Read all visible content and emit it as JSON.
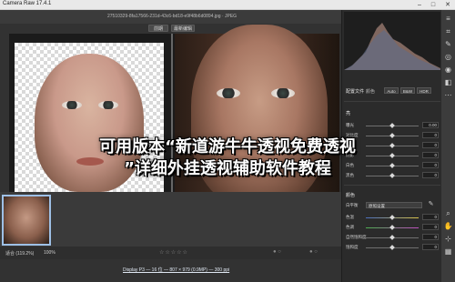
{
  "window": {
    "title": "Camera Raw 17.4.1",
    "minimize_glyph": "–",
    "maximize_glyph": "□",
    "close_glyph": "✕"
  },
  "file": {
    "name": "27510329-8fa17566-231d-43c6-bd18-e9f48b6d0894.jpg  ·  JPEG"
  },
  "view_tabs": [
    {
      "label": "前期"
    },
    {
      "label": "最新编辑"
    }
  ],
  "status": {
    "zoom_fit": "适合 (119.2%)",
    "zoom_100": "100%",
    "stars": "☆☆☆☆☆",
    "dots_left": "● ○",
    "dots_right": "● ○"
  },
  "info_link": "Display P3 — 16 位 — 807 × 979 (0.9MP) — 300 ppi",
  "panel": {
    "profile_label": "配置文件",
    "profile_value": "颜色",
    "mode_auto": "Auto",
    "mode_bw": "B&W",
    "mode_hdr": "HDR",
    "light_section": "亮",
    "light_sliders": [
      {
        "label": "曝光",
        "value": "0.00",
        "knob_pos": 0.5
      },
      {
        "label": "对比度",
        "value": "0",
        "knob_pos": 0.5
      },
      {
        "label": "高光",
        "value": "0",
        "knob_pos": 0.5
      },
      {
        "label": "阴影",
        "value": "0",
        "knob_pos": 0.5
      },
      {
        "label": "白色",
        "value": "0",
        "knob_pos": 0.5
      },
      {
        "label": "黑色",
        "value": "0",
        "knob_pos": 0.5
      }
    ],
    "color_section": "颜色",
    "white_balance_label": "白平衡",
    "white_balance_value": "原照设置",
    "color_sliders": [
      {
        "label": "色温",
        "value": "0",
        "knob_pos": 0.5
      },
      {
        "label": "色调",
        "value": "0",
        "knob_pos": 0.5
      },
      {
        "label": "自然饱和度",
        "value": "0",
        "knob_pos": 0.5
      },
      {
        "label": "饱和度",
        "value": "0",
        "knob_pos": 0.5
      }
    ]
  },
  "tools": [
    {
      "icon": "edit-icon",
      "glyph": "≡"
    },
    {
      "icon": "crop-icon",
      "glyph": "⌗"
    },
    {
      "icon": "heal-icon",
      "glyph": "✎"
    },
    {
      "icon": "mask-icon",
      "glyph": "◎"
    },
    {
      "icon": "redeye-icon",
      "glyph": "◉"
    },
    {
      "icon": "presets-icon",
      "glyph": "◧"
    },
    {
      "icon": "more-icon",
      "glyph": "⋯"
    },
    {
      "icon": "zoom-icon",
      "glyph": "⌕"
    },
    {
      "icon": "hand-icon",
      "glyph": "✋"
    },
    {
      "icon": "sampler-icon",
      "glyph": "⊹"
    },
    {
      "icon": "grid-icon",
      "glyph": "▦"
    }
  ],
  "overlay": {
    "line1": "可用版本“新道游牛牛透视免费透视",
    "line2": "”详细外挂透视辅助软件教程"
  },
  "colors": {
    "panel_bg": "#2b2b2b",
    "accent": "#9ec0e6"
  }
}
